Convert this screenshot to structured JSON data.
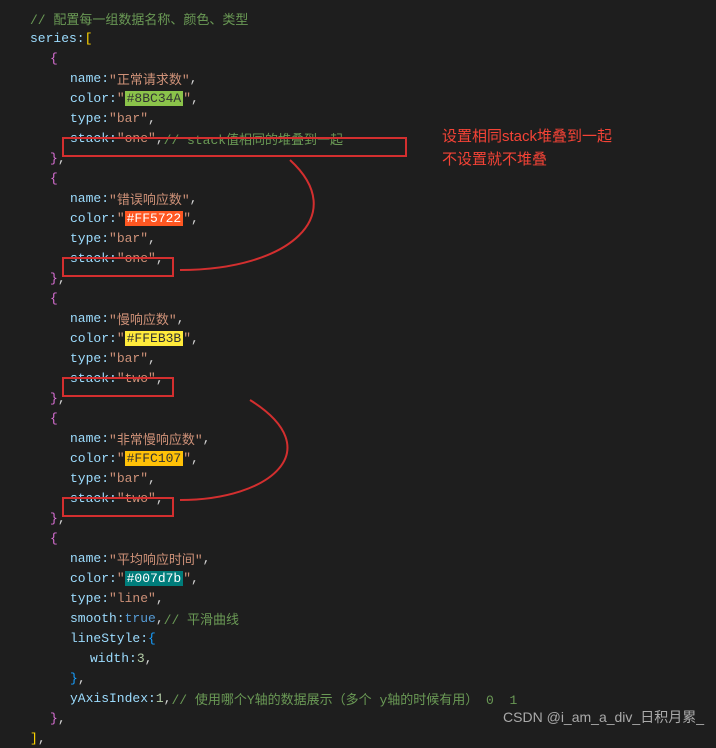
{
  "comments": {
    "top": "// 配置每一组数据名称、颜色、类型",
    "stack_note": "// stack值相同的堆叠到一起",
    "smooth_note": "// 平滑曲线",
    "yaxis_note": "// 使用哪个Y轴的数据展示（多个 y轴的时候有用） 0  1"
  },
  "code": {
    "series_key": "series:",
    "name_key": "name:",
    "color_key": "color:",
    "type_key": "type:",
    "stack_key": "stack:",
    "smooth_key": "smooth:",
    "lineStyle_key": "lineStyle:",
    "width_key": "width:",
    "yAxisIndex_key": "yAxisIndex:",
    "true_val": "true",
    "width_val": "3",
    "yaxis_val": "1"
  },
  "series": [
    {
      "name": "\"正常请求数\"",
      "color": "#8BC34A",
      "type": "\"bar\"",
      "stack": "\"one\""
    },
    {
      "name": "\"错误响应数\"",
      "color": "#FF5722",
      "type": "\"bar\"",
      "stack": "\"one\""
    },
    {
      "name": "\"慢响应数\"",
      "color": "#FFEB3B",
      "type": "\"bar\"",
      "stack": "\"two\""
    },
    {
      "name": "\"非常慢响应数\"",
      "color": "#FFC107",
      "type": "\"bar\"",
      "stack": "\"two\""
    },
    {
      "name": "\"平均响应时间\"",
      "color": "#007d7b",
      "type": "\"line\""
    }
  ],
  "annotations": {
    "line1": "设置相同stack堆叠到一起",
    "line2": "不设置就不堆叠"
  },
  "watermark": "CSDN @i_am_a_div_日积月累_"
}
